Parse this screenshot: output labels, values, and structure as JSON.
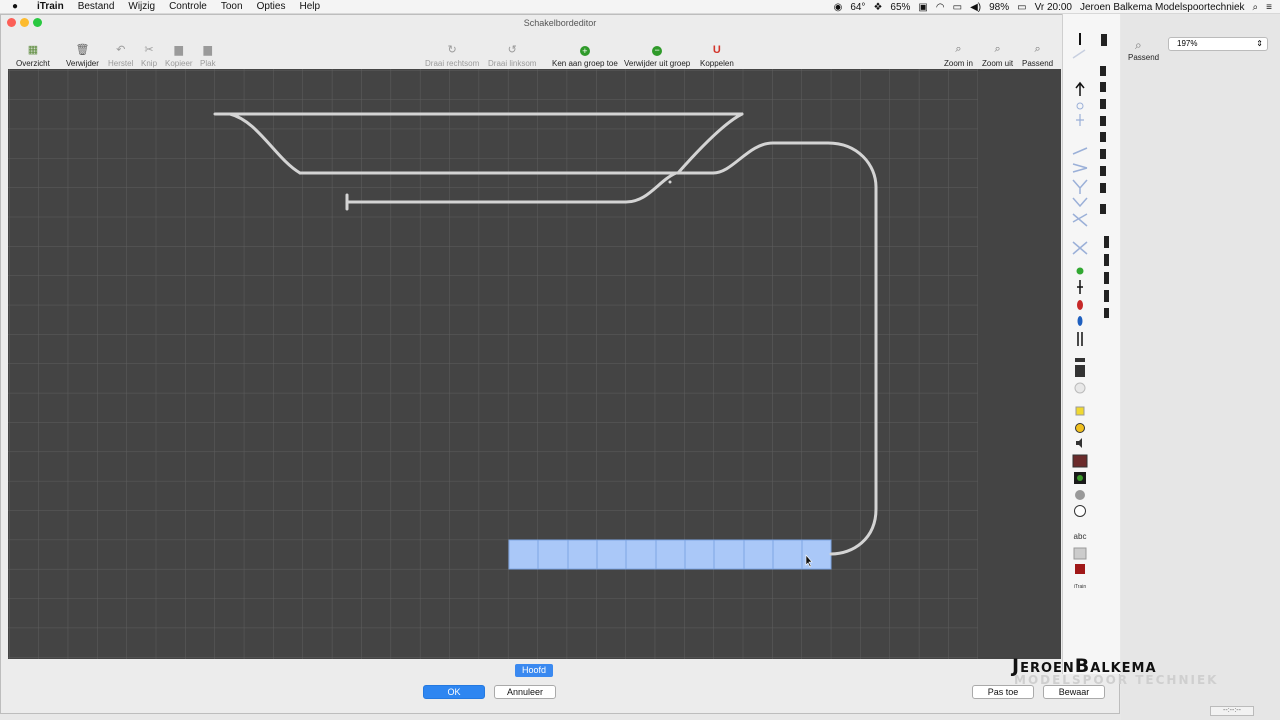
{
  "menubar": {
    "app": "iTrain",
    "items": [
      "Bestand",
      "Wijzig",
      "Controle",
      "Toon",
      "Opties",
      "Help"
    ],
    "status": {
      "temperature": "64°",
      "percent": "65%",
      "battery": "98%",
      "clock": "Vr 20:00",
      "user": "Jeroen Balkema Modelspoortechniek"
    }
  },
  "window": {
    "title": "Schakelbordeditor"
  },
  "toolbar": {
    "overview": "Overzicht",
    "delete": "Verwijder",
    "restore": "Herstel",
    "cut": "Knip",
    "copy": "Kopieer",
    "paste": "Plak",
    "rotate_right": "Draai rechtsom",
    "rotate_left": "Draai linksom",
    "add_group": "Ken aan groep toe",
    "remove_group": "Verwijder uit groep",
    "couple": "Koppelen",
    "zoom_in": "Zoom in",
    "zoom_out": "Zoom uit",
    "fit": "Passend"
  },
  "side": {
    "fit_label": "Passend",
    "zoom_value": "197%"
  },
  "bottom": {
    "tab": "Hoofd",
    "ok": "OK",
    "cancel": "Annuleer",
    "apply": "Pas toe",
    "save": "Bewaar",
    "indicator": "--:--:--"
  },
  "brand": {
    "line1": "JeroenBalkema",
    "line2": "MODELSPOOR TECHNIEK"
  },
  "palette": {
    "text_tool": "abc",
    "logo": "iTrain"
  },
  "colors": {
    "canvas": "#444444",
    "grid": "#5c5c5c",
    "track": "#d4d4d4",
    "selection": "#aac8f8",
    "accent": "#2e86f1"
  }
}
